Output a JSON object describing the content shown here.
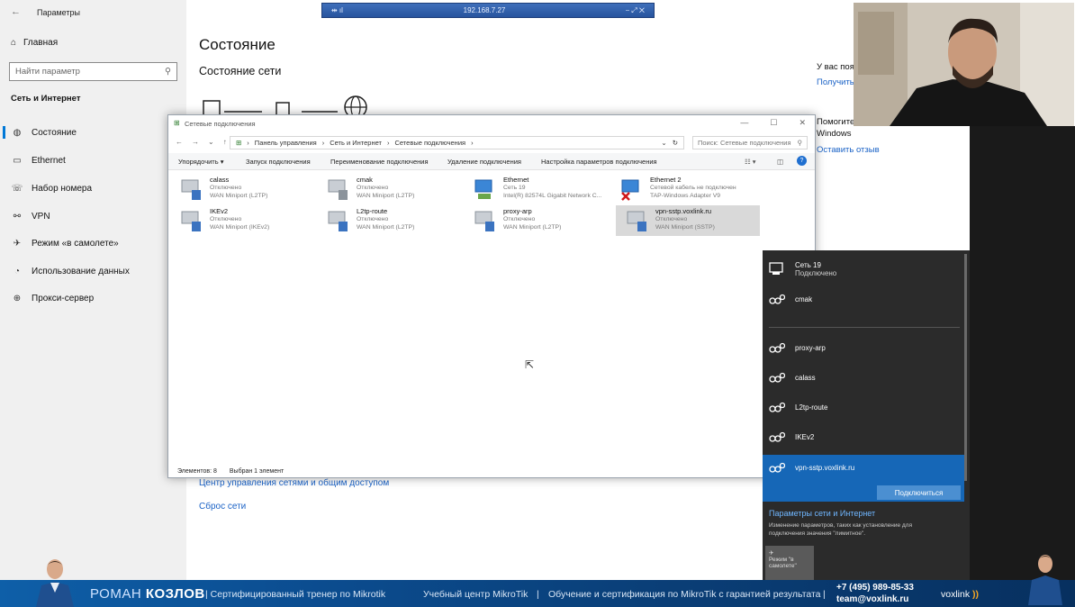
{
  "settings": {
    "window_title": "Параметры",
    "home": "Главная",
    "search_placeholder": "Найти параметр",
    "section": "Сеть и Интернет",
    "items": [
      {
        "label": "Состояние"
      },
      {
        "label": "Ethernet"
      },
      {
        "label": "Набор номера"
      },
      {
        "label": "VPN"
      },
      {
        "label": "Режим «в самолете»"
      },
      {
        "label": "Использование данных"
      },
      {
        "label": "Прокси-сервер"
      }
    ],
    "main": {
      "title": "Состояние",
      "subtitle": "Состояние сети",
      "link_center": "Центр управления сетями и общим доступом",
      "link_reset": "Сброс сети",
      "right_text1": "У вас поя",
      "right_link1": "Получить",
      "right_text2a": "Помогите",
      "right_text2b": "Windows",
      "right_link2": "Оставить отзыв"
    }
  },
  "rdp": {
    "host": "192.168.7.27",
    "left": "⇹ ıl",
    "right": "⎯  ⤢  ✕"
  },
  "explorer": {
    "title": "Сетевые подключения",
    "breadcrumb": [
      "Панель управления",
      "Сеть и Интернет",
      "Сетевые подключения"
    ],
    "search_placeholder": "Поиск: Сетевые подключения",
    "commands": [
      "Упорядочить ▾",
      "Запуск подключения",
      "Переименование подключения",
      "Удаление подключения",
      "Настройка параметров подключения"
    ],
    "connections": [
      {
        "name": "calass",
        "status": "Отключено",
        "device": "WAN Miniport (L2TP)"
      },
      {
        "name": "cmak",
        "status": "Отключено",
        "device": "WAN Miniport (L2TP)"
      },
      {
        "name": "Ethernet",
        "status": "Сеть 19",
        "device": "Intel(R) 82574L Gigabit Network C..."
      },
      {
        "name": "Ethernet 2",
        "status": "Сетевой кабель не подключен",
        "device": "TAP-Windows Adapter V9"
      },
      {
        "name": "IKEv2",
        "status": "Отключено",
        "device": "WAN Miniport (IKEv2)"
      },
      {
        "name": "L2tp-route",
        "status": "Отключено",
        "device": "WAN Miniport (L2TP)"
      },
      {
        "name": "proxy-arp",
        "status": "Отключено",
        "device": "WAN Miniport (L2TP)"
      },
      {
        "name": "vpn-sstp.voxlink.ru",
        "status": "Отключено",
        "device": "WAN Miniport (SSTP)"
      }
    ],
    "status_count": "Элементов: 8",
    "status_selected": "Выбран 1 элемент"
  },
  "flyout": {
    "network": {
      "name": "Сеть 19",
      "status": "Подключено"
    },
    "vpns": [
      "cmak",
      "proxy-arp",
      "calass",
      "L2tp-route",
      "IKEv2",
      "vpn-sstp.voxlink.ru"
    ],
    "connect_button": "Подключиться",
    "params_link": "Параметры сети и Интернет",
    "params_desc": "Изменение параметров, таких как установление для подключения значения \"лимитное\".",
    "tile_label": "Режим \"в самолете\""
  },
  "banner": {
    "first": "РОМАН",
    "last": "КОЗЛОВ",
    "role": "| Сертифицированный тренер по Mikrotik",
    "center": "Учебный центр MikroTik",
    "sep": "|",
    "course": "Обучение и сертификация по MikroTik с гарантией результата",
    "phone": "+7 (495) 989-85-33",
    "email": "team@voxlink.ru",
    "logo": "voxlink"
  },
  "colors": {
    "accent": "#0078d7",
    "flyout_bg": "#2b2b2b",
    "flyout_selected": "#1667b7",
    "banner": "#0b4c8f",
    "link": "#1a62c6"
  }
}
